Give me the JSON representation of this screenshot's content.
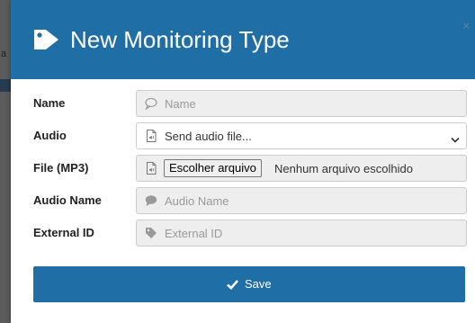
{
  "backdrop": {
    "partial_char": "a"
  },
  "modal": {
    "title": "New Monitoring Type",
    "title_icon": "tag-icon",
    "close_label": "×"
  },
  "form": {
    "name": {
      "label": "Name",
      "placeholder": "Name",
      "icon": "speech-bubble-icon"
    },
    "audio": {
      "label": "Audio",
      "selected": "Send audio file...",
      "icon": "audio-file-icon"
    },
    "file": {
      "label": "File (MP3)",
      "button_label": "Escolher arquivo",
      "status": "Nenhum arquivo escolhido",
      "icon": "audio-file-icon"
    },
    "audio_name": {
      "label": "Audio Name",
      "placeholder": "Audio Name",
      "icon": "comment-icon"
    },
    "external_id": {
      "label": "External ID",
      "placeholder": "External ID",
      "icon": "tag-icon"
    }
  },
  "actions": {
    "save_label": "Save",
    "save_icon": "check-icon"
  },
  "colors": {
    "accent": "#1f6ea5",
    "field_bg": "#eeeeee",
    "placeholder": "#999999"
  }
}
